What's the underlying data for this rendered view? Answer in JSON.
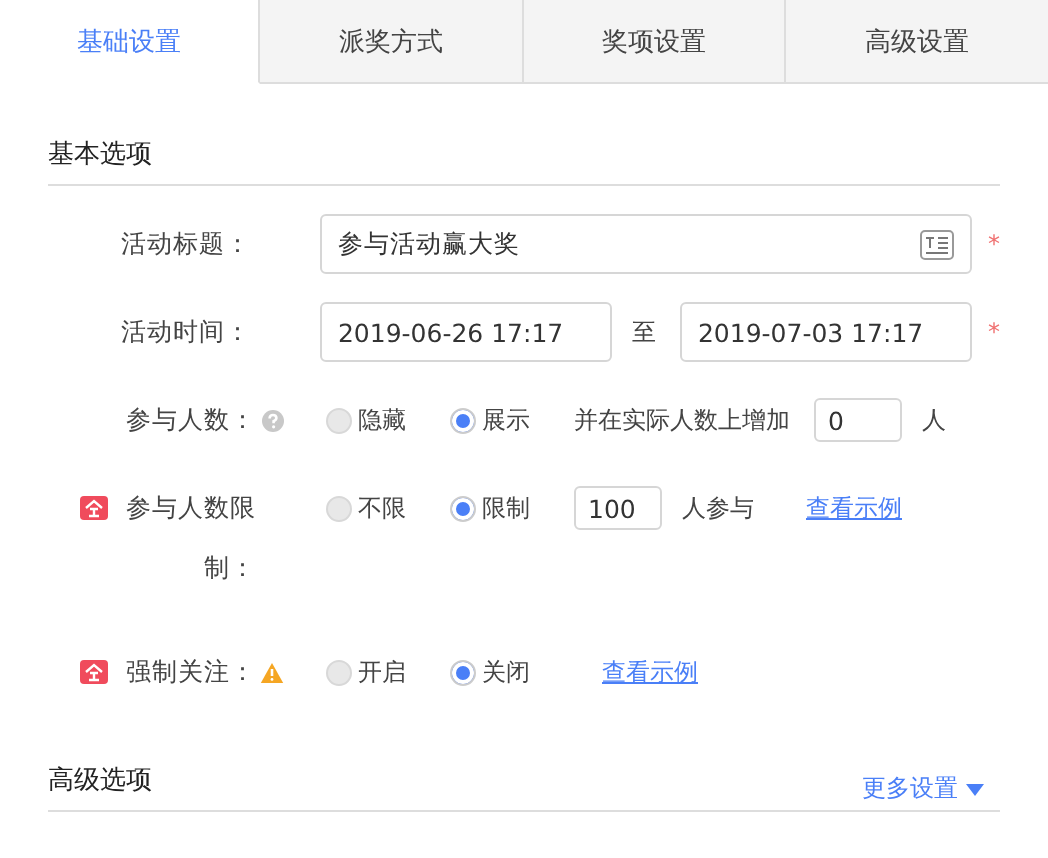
{
  "tabs": [
    {
      "label": "基础设置",
      "selected": true
    },
    {
      "label": "派奖方式",
      "selected": false
    },
    {
      "label": "奖项设置",
      "selected": false
    },
    {
      "label": "高级设置",
      "selected": false
    }
  ],
  "basic": {
    "title": "基本选项",
    "fields": [
      {
        "label": "活动标题：",
        "badge": false,
        "help": false,
        "warning": false,
        "required_mark": "*",
        "controls": [
          {
            "kind": "wide_input",
            "value": "参与活动赢大奖",
            "has_icon": true
          }
        ]
      },
      {
        "label": "活动时间：",
        "badge": false,
        "help": false,
        "warning": false,
        "required_mark": "*",
        "controls": [
          {
            "kind": "date_input",
            "value": "2019-06-26 17:17"
          },
          {
            "kind": "text",
            "text": "至"
          },
          {
            "kind": "date_input",
            "value": "2019-07-03 17:17"
          }
        ]
      },
      {
        "label": "参与人数：",
        "badge": false,
        "help": true,
        "warning": false,
        "controls": [
          {
            "kind": "radio",
            "label": "隐藏",
            "selected": false
          },
          {
            "kind": "radio",
            "label": "展示",
            "selected": true
          },
          {
            "kind": "text",
            "text": "并在实际人数上增加"
          },
          {
            "kind": "number_input",
            "value": "0"
          },
          {
            "kind": "text",
            "text": "人"
          }
        ]
      },
      {
        "label": "参与人数限制：",
        "badge": true,
        "help": false,
        "warning": false,
        "controls": [
          {
            "kind": "radio",
            "label": "不限",
            "selected": false
          },
          {
            "kind": "radio",
            "label": "限制",
            "selected": true
          },
          {
            "kind": "number_input",
            "value": "100"
          },
          {
            "kind": "text",
            "text": "人参与"
          },
          {
            "kind": "link",
            "text": "查看示例"
          }
        ]
      },
      {
        "label": "强制关注：",
        "badge": true,
        "help": false,
        "warning": true,
        "controls": [
          {
            "kind": "radio",
            "label": "开启",
            "selected": false
          },
          {
            "kind": "radio",
            "label": "关闭",
            "selected": true
          },
          {
            "kind": "link",
            "text": "查看示例"
          }
        ]
      }
    ]
  },
  "advanced": {
    "title": "高级选项",
    "more": "更多设置"
  }
}
